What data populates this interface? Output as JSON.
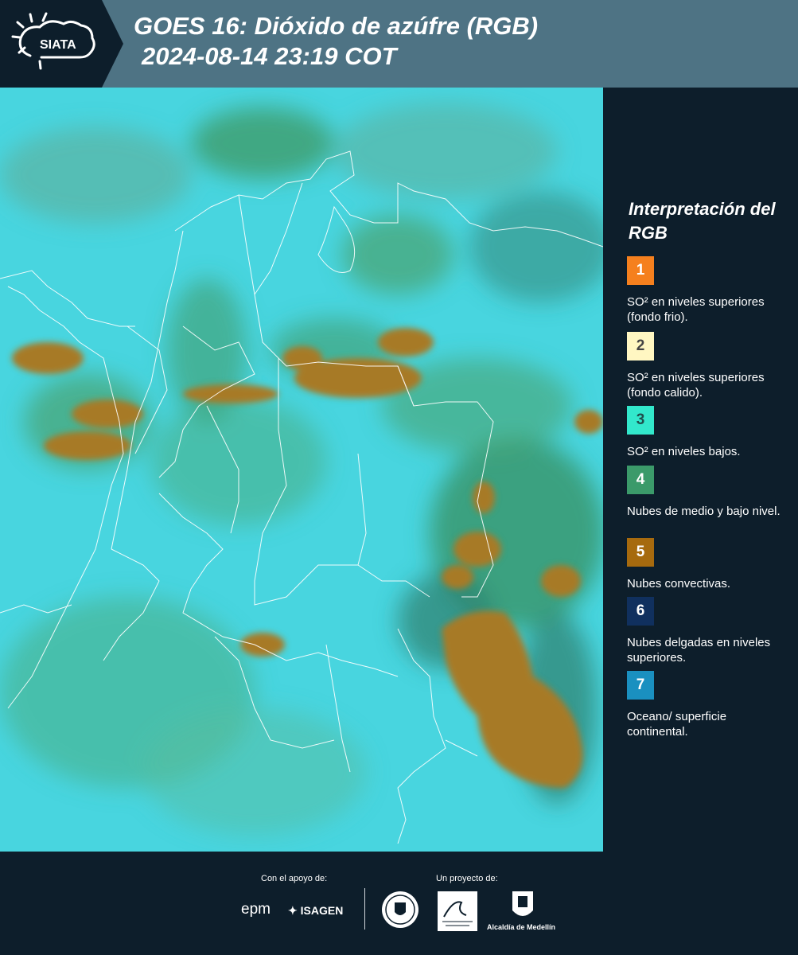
{
  "header": {
    "brand": "SIATA",
    "title": "GOES 16: Dióxido de azúfre (RGB)",
    "subtitle": "2024-08-14 23:19 COT"
  },
  "legend": {
    "title": "Interpretación del RGB",
    "items": [
      {
        "num": "1",
        "color": "#f5801e",
        "label": "SO² en niveles superiores (fondo frio)."
      },
      {
        "num": "2",
        "color": "#fff7c2",
        "label": "SO² en niveles superiores (fondo calido)."
      },
      {
        "num": "3",
        "color": "#32e8cc",
        "label": "SO² en niveles bajos."
      },
      {
        "num": "4",
        "color": "#3b9a6a",
        "label": "Nubes de medio y bajo nivel."
      },
      {
        "num": "5",
        "color": "#a66a0e",
        "label": "Nubes convectivas."
      },
      {
        "num": "6",
        "color": "#10305e",
        "label": "Nubes delgadas en niveles superiores."
      },
      {
        "num": "7",
        "color": "#1a90c0",
        "label": "Oceano/ superficie continental."
      }
    ]
  },
  "footer": {
    "support_label": "Con el apoyo de:",
    "project_label": "Un proyecto de:",
    "sponsors": [
      "epm",
      "ISAGEN"
    ],
    "partners": [
      "Área Metropolitana Valle de Aburrá",
      "Alcaldía de Medellín"
    ]
  }
}
